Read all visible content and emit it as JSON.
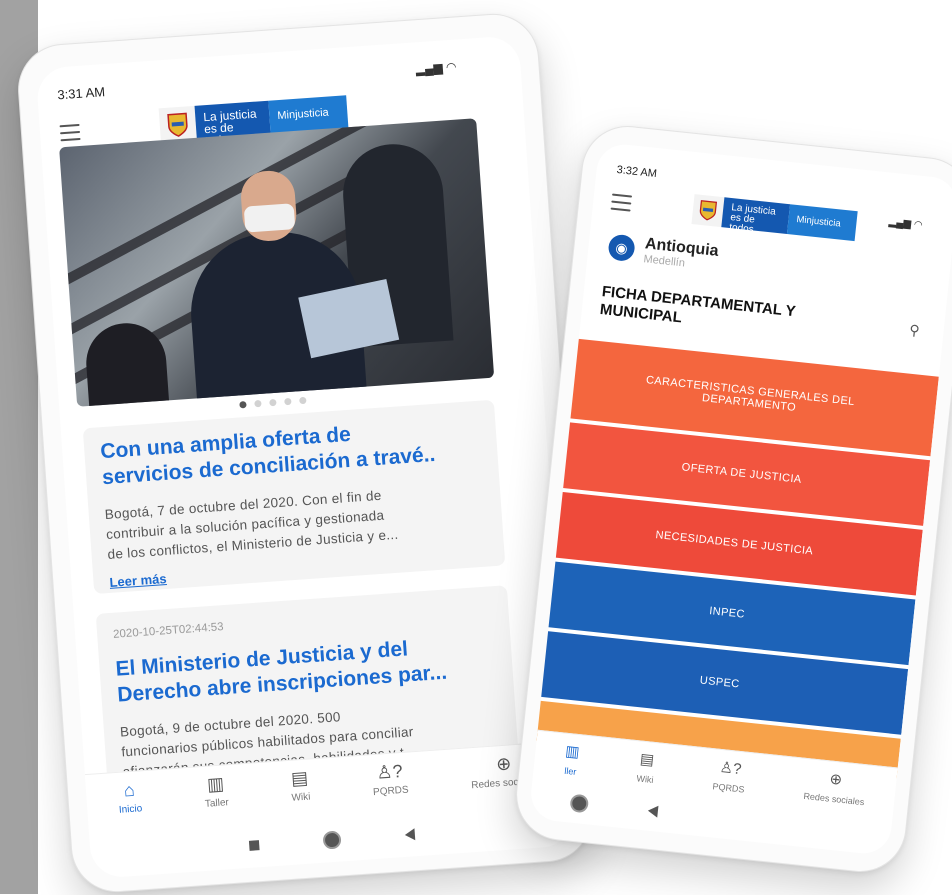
{
  "phone1": {
    "status": {
      "time": "3:31 AM"
    },
    "logo": {
      "line1": "La justicia",
      "line2": "es de todos",
      "ministry": "Minjusticia"
    },
    "carousel": {
      "count": 5,
      "active_index": 0
    },
    "cards": [
      {
        "title_line1": "Con una amplia oferta de",
        "title_line2": "servicios de conciliación a travé..",
        "text_line1": "Bogotá, 7 de octubre del 2020. Con el fin de",
        "text_line2": "contribuir a la solución pacífica y gestionada",
        "text_line3": "de los conflictos, el Ministerio de Justicia y e...",
        "link": "Leer más"
      },
      {
        "date": "2020-10-25T02:44:53",
        "title_line1": "El Ministerio de Justicia y del",
        "title_line2": "Derecho abre inscripciones par...",
        "text_line1": "Bogotá, 9 de octubre del 2020.   500",
        "text_line2": "funcionarios públicos habilitados para conciliar",
        "text_line3": "afianzarán sus competencias, habilidades y t..."
      }
    ],
    "nav": [
      {
        "label": "Inicio",
        "icon": "home-icon"
      },
      {
        "label": "Taller",
        "icon": "building-icon"
      },
      {
        "label": "Wiki",
        "icon": "wiki-icon"
      },
      {
        "label": "PQRDS",
        "icon": "user-question-icon"
      },
      {
        "label": "Redes sociales",
        "icon": "globe-icon"
      }
    ]
  },
  "phone2": {
    "status": {
      "time": "3:32 AM"
    },
    "logo": {
      "line1": "La justicia",
      "line2": "es de todos",
      "ministry": "Minjusticia"
    },
    "location": {
      "title": "Antioquia",
      "subtitle": "Medellín"
    },
    "section_title_line1": "FICHA DEPARTAMENTAL Y",
    "section_title_line2": "MUNICIPAL",
    "tiles": [
      {
        "line1": "CARACTERISTICAS GENERALES DEL",
        "line2": "DEPARTAMENTO",
        "color": "#f4663e"
      },
      {
        "line1": "OFERTA DE JUSTICIA",
        "color": "#f2553f"
      },
      {
        "line1": "NECESIDADES DE JUSTICIA",
        "color": "#ee4a3a"
      },
      {
        "line1": "INPEC",
        "color": "#1d63b8"
      },
      {
        "line1": "USPEC",
        "color": "#1d5fb5"
      },
      {
        "line1": "",
        "color": "#f7a24a"
      }
    ],
    "nav": [
      {
        "label": "ller",
        "icon": "building-icon"
      },
      {
        "label": "Wiki",
        "icon": "wiki-icon"
      },
      {
        "label": "PQRDS",
        "icon": "user-question-icon"
      },
      {
        "label": "Redes sociales",
        "icon": "globe-icon"
      }
    ]
  },
  "colors": {
    "brand_blue": "#1b6ad0",
    "logo_blue": "#1458b0"
  }
}
